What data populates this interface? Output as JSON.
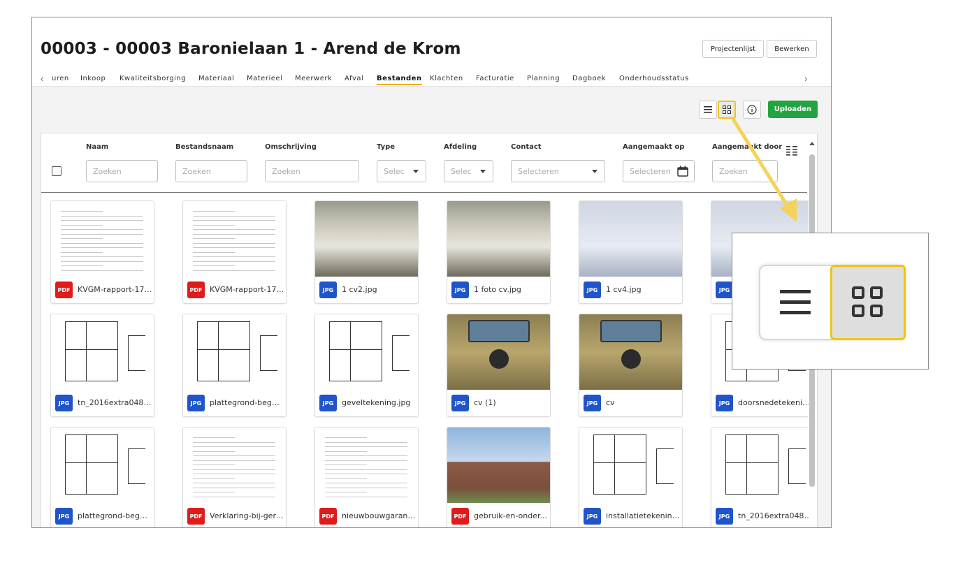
{
  "header": {
    "title": "00003 - 00003 Baronielaan 1 - Arend de Krom",
    "projectenlijst_label": "Projectenlijst",
    "bewerken_label": "Bewerken"
  },
  "tabs": [
    {
      "label": "uren"
    },
    {
      "label": "Inkoop"
    },
    {
      "label": "Kwaliteitsborging"
    },
    {
      "label": "Materiaal"
    },
    {
      "label": "Materieel"
    },
    {
      "label": "Meerwerk"
    },
    {
      "label": "Afval"
    },
    {
      "label": "Bestanden",
      "active": true
    },
    {
      "label": "Klachten"
    },
    {
      "label": "Facturatie"
    },
    {
      "label": "Planning"
    },
    {
      "label": "Dagboek"
    },
    {
      "label": "Onderhoudsstatus"
    }
  ],
  "toolbar": {
    "upload_label": "Uploaden",
    "view_mode": "grid"
  },
  "columns": {
    "naam": "Naam",
    "bestandsnaam": "Bestandsnaam",
    "omschrijving": "Omschrijving",
    "type": "Type",
    "afdeling": "Afdeling",
    "contact": "Contact",
    "aangemaakt_op": "Aangemaakt op",
    "aangemaakt_door": "Aangemaakt door"
  },
  "filters": {
    "naam": "Zoeken",
    "bestandsnaam": "Zoeken",
    "omschrijving": "Zoeken",
    "type": "Selec",
    "afdeling": "Selec",
    "contact": "Selecteren",
    "aangemaakt_op": "Selecteren",
    "aangemaakt_door": "Zoeken"
  },
  "files": [
    {
      "type": "PDF",
      "name": "KVGM-rapport-17...",
      "thumb": "doc"
    },
    {
      "type": "PDF",
      "name": "KVGM-rapport-17...",
      "thumb": "doc"
    },
    {
      "type": "JPG",
      "name": "1 cv2.jpg",
      "thumb": "boiler"
    },
    {
      "type": "JPG",
      "name": "1 foto cv.jpg",
      "thumb": "boiler"
    },
    {
      "type": "JPG",
      "name": "1 cv4.jpg",
      "thumb": "scan"
    },
    {
      "type": "JPG",
      "name": "",
      "thumb": "scan"
    },
    {
      "type": "JPG",
      "name": "tn_2016extra048 ...",
      "thumb": "drawing"
    },
    {
      "type": "JPG",
      "name": "plattegrond-began...",
      "thumb": "drawing"
    },
    {
      "type": "JPG",
      "name": "geveltekening.jpg",
      "thumb": "drawing"
    },
    {
      "type": "JPG",
      "name": "cv (1)",
      "thumb": "cv"
    },
    {
      "type": "JPG",
      "name": "cv",
      "thumb": "cv"
    },
    {
      "type": "JPG",
      "name": "doorsnedetekenin...",
      "thumb": "drawing"
    },
    {
      "type": "JPG",
      "name": "plattegrond-began...",
      "thumb": "drawing"
    },
    {
      "type": "PDF",
      "name": "Verklaring-bij-gere...",
      "thumb": "doc"
    },
    {
      "type": "PDF",
      "name": "nieuwbouwgaranti...",
      "thumb": "doc"
    },
    {
      "type": "PDF",
      "name": "gebruik-en-onder...",
      "thumb": "building"
    },
    {
      "type": "JPG",
      "name": "installatietekening...",
      "thumb": "drawing"
    },
    {
      "type": "JPG",
      "name": "tn_2016extra048 ...",
      "thumb": "drawing"
    }
  ],
  "colors": {
    "upload_green": "#22a541",
    "highlight_yellow": "#f1c40f",
    "pdf_red": "#e01b1b",
    "jpg_blue": "#1f55c8"
  }
}
